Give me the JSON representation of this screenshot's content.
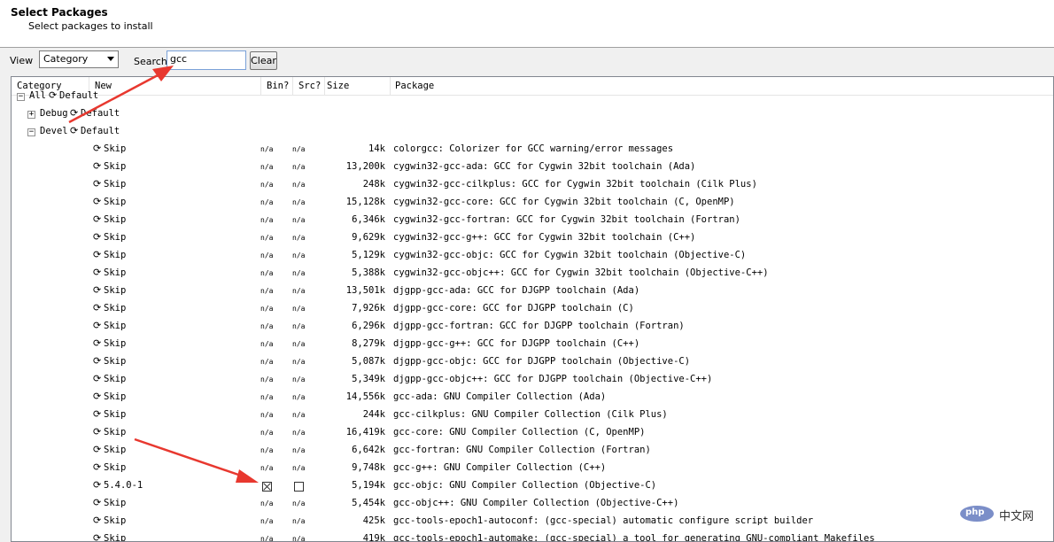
{
  "header": {
    "title": "Select Packages",
    "subtitle": "Select packages to install"
  },
  "toolbar": {
    "view_label": "View",
    "view_value": "Category",
    "search_label": "Search",
    "search_value": "gcc",
    "clear_label": "Clear"
  },
  "columns": {
    "category": "Category",
    "new": "New",
    "bin": "Bin?",
    "src": "Src?",
    "size": "Size",
    "package": "Package"
  },
  "tree": {
    "all": {
      "label": "All",
      "action": "Default"
    },
    "debug": {
      "label": "Debug",
      "action": "Default"
    },
    "devel": {
      "label": "Devel",
      "action": "Default"
    }
  },
  "na_label": "n/a",
  "packages": [
    {
      "action": "Skip",
      "size": "14k",
      "desc": "colorgcc: Colorizer for GCC warning/error messages"
    },
    {
      "action": "Skip",
      "size": "13,200k",
      "desc": "cygwin32-gcc-ada: GCC for Cygwin 32bit toolchain (Ada)"
    },
    {
      "action": "Skip",
      "size": "248k",
      "desc": "cygwin32-gcc-cilkplus: GCC for Cygwin 32bit toolchain (Cilk Plus)"
    },
    {
      "action": "Skip",
      "size": "15,128k",
      "desc": "cygwin32-gcc-core: GCC for Cygwin 32bit toolchain (C, OpenMP)"
    },
    {
      "action": "Skip",
      "size": "6,346k",
      "desc": "cygwin32-gcc-fortran: GCC for Cygwin 32bit toolchain (Fortran)"
    },
    {
      "action": "Skip",
      "size": "9,629k",
      "desc": "cygwin32-gcc-g++: GCC for Cygwin 32bit toolchain (C++)"
    },
    {
      "action": "Skip",
      "size": "5,129k",
      "desc": "cygwin32-gcc-objc: GCC for Cygwin 32bit toolchain (Objective-C)"
    },
    {
      "action": "Skip",
      "size": "5,388k",
      "desc": "cygwin32-gcc-objc++: GCC for Cygwin 32bit toolchain (Objective-C++)"
    },
    {
      "action": "Skip",
      "size": "13,501k",
      "desc": "djgpp-gcc-ada: GCC for DJGPP toolchain (Ada)"
    },
    {
      "action": "Skip",
      "size": "7,926k",
      "desc": "djgpp-gcc-core: GCC for DJGPP toolchain (C)"
    },
    {
      "action": "Skip",
      "size": "6,296k",
      "desc": "djgpp-gcc-fortran: GCC for DJGPP toolchain (Fortran)"
    },
    {
      "action": "Skip",
      "size": "8,279k",
      "desc": "djgpp-gcc-g++: GCC for DJGPP toolchain (C++)"
    },
    {
      "action": "Skip",
      "size": "5,087k",
      "desc": "djgpp-gcc-objc: GCC for DJGPP toolchain (Objective-C)"
    },
    {
      "action": "Skip",
      "size": "5,349k",
      "desc": "djgpp-gcc-objc++: GCC for DJGPP toolchain (Objective-C++)"
    },
    {
      "action": "Skip",
      "size": "14,556k",
      "desc": "gcc-ada: GNU Compiler Collection (Ada)"
    },
    {
      "action": "Skip",
      "size": "244k",
      "desc": "gcc-cilkplus: GNU Compiler Collection (Cilk Plus)"
    },
    {
      "action": "Skip",
      "size": "16,419k",
      "desc": "gcc-core: GNU Compiler Collection (C, OpenMP)"
    },
    {
      "action": "Skip",
      "size": "6,642k",
      "desc": "gcc-fortran: GNU Compiler Collection (Fortran)"
    },
    {
      "action": "Skip",
      "size": "9,748k",
      "desc": "gcc-g++: GNU Compiler Collection (C++)"
    },
    {
      "action": "5.4.0-1",
      "size": "5,194k",
      "desc": "gcc-objc: GNU Compiler Collection (Objective-C)",
      "checkbox": true,
      "bin_checked": true,
      "src_checked": false
    },
    {
      "action": "Skip",
      "size": "5,454k",
      "desc": "gcc-objc++: GNU Compiler Collection (Objective-C++)"
    },
    {
      "action": "Skip",
      "size": "425k",
      "desc": "gcc-tools-epoch1-autoconf: (gcc-special) automatic configure script builder"
    },
    {
      "action": "Skip",
      "size": "419k",
      "desc": "gcc-tools-epoch1-automake: (gcc-special) a tool for generating GNU-compliant Makefiles"
    }
  ],
  "icons": {
    "cycle": "cycle-arrows-icon",
    "expand": "plus-box-icon",
    "collapse": "minus-box-icon"
  },
  "colors": {
    "annotation_arrow": "#e8382f",
    "selection_border": "#7aa1d8"
  },
  "watermark": {
    "logo_text": "php",
    "site_text": "中文网"
  }
}
